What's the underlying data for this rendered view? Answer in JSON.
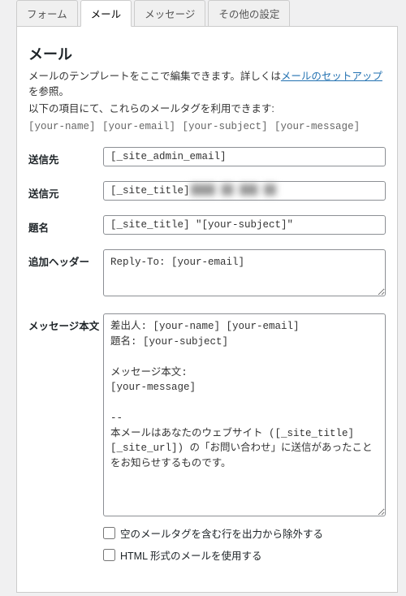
{
  "tabs": {
    "form": "フォーム",
    "mail": "メール",
    "messages": "メッセージ",
    "other": "その他の設定"
  },
  "heading": "メール",
  "desc_prefix": "メールのテンプレートをここで編集できます。詳しくは",
  "desc_link": "メールのセットアップ",
  "desc_suffix": "を参照。",
  "desc_line2": "以下の項目にて、これらのメールタグを利用できます:",
  "tags_line": "[your-name] [your-email] [your-subject] [your-message]",
  "labels": {
    "to": "送信先",
    "from": "送信元",
    "subject": "題名",
    "headers": "追加ヘッダー",
    "body": "メッセージ本文"
  },
  "values": {
    "to": "[_site_admin_email]",
    "from": "[_site_title] ",
    "from_hidden": "████ ██ ███ ██",
    "subject": "[_site_title] \"[your-subject]\"",
    "headers": "Reply-To: [your-email]",
    "body": "差出人: [your-name] [your-email]\n題名: [your-subject]\n\nメッセージ本文:\n[your-message]\n\n-- \n本メールはあなたのウェブサイト ([_site_title] [_site_url]) の「お問い合わせ」に送信があったことをお知らせするものです。"
  },
  "checkboxes": {
    "exclude_blank": "空のメールタグを含む行を出力から除外する",
    "use_html": "HTML 形式のメールを使用する"
  }
}
